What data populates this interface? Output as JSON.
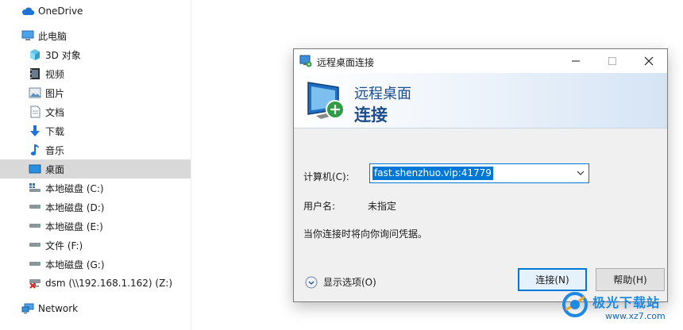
{
  "nav": {
    "items": [
      {
        "label": "OneDrive",
        "icon": "onedrive-cloud-icon",
        "level": 1
      },
      {
        "label": "此电脑",
        "icon": "this-pc-icon",
        "level": 1
      },
      {
        "label": "3D 对象",
        "icon": "3d-objects-icon",
        "level": 2
      },
      {
        "label": "视频",
        "icon": "videos-icon",
        "level": 2
      },
      {
        "label": "图片",
        "icon": "pictures-icon",
        "level": 2
      },
      {
        "label": "文档",
        "icon": "documents-icon",
        "level": 2
      },
      {
        "label": "下载",
        "icon": "downloads-icon",
        "level": 2
      },
      {
        "label": "音乐",
        "icon": "music-icon",
        "level": 2
      },
      {
        "label": "桌面",
        "icon": "desktop-icon",
        "level": 2,
        "selected": true
      },
      {
        "label": "本地磁盘 (C:)",
        "icon": "system-drive-icon",
        "level": 2
      },
      {
        "label": "本地磁盘 (D:)",
        "icon": "drive-icon",
        "level": 2
      },
      {
        "label": "本地磁盘 (E:)",
        "icon": "drive-icon",
        "level": 2
      },
      {
        "label": "文件 (F:)",
        "icon": "drive-icon",
        "level": 2
      },
      {
        "label": "本地磁盘 (G:)",
        "icon": "drive-icon",
        "level": 2
      },
      {
        "label": "dsm (\\\\192.168.1.162) (Z:)",
        "icon": "disconnected-network-drive-icon",
        "level": 2
      },
      {
        "label": "Network",
        "icon": "network-icon",
        "level": 1
      }
    ],
    "selected_bg": "#d9d9d9"
  },
  "dialog": {
    "title": "远程桌面连接",
    "banner_line1": "远程桌面",
    "banner_line2": "连接",
    "computer_label": "计算机(C):",
    "computer_value": "fast.shenzhuo.vip:41779",
    "user_label": "用户名:",
    "user_value": "未指定",
    "hint": "当你连接时将向你询问凭据。",
    "show_options": "显示选项(O)",
    "connect_button": "连接(N)",
    "help_button": "帮助(H)",
    "accent_color": "#0078d7",
    "banner_text_color": "#1b4d8f"
  },
  "watermark": {
    "text": "极光下载站",
    "url": "www.xz7.com"
  }
}
